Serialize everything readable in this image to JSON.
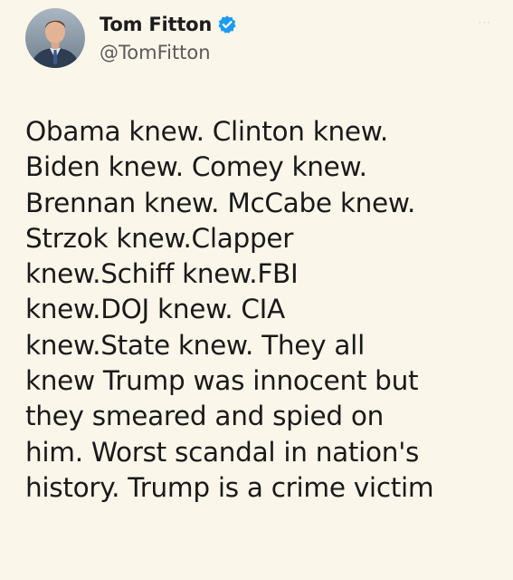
{
  "author": {
    "display_name": "Tom Fitton",
    "handle": "@TomFitton",
    "verified": true,
    "avatar_icon": "profile-photo-icon",
    "verified_icon": "verified-badge-icon"
  },
  "menu": {
    "more_label": "···"
  },
  "tweet": {
    "lines": [
      "Obama knew. Clinton knew.",
      "Biden knew. Comey knew.",
      "Brennan knew. McCabe knew.",
      "Strzok knew.Clapper",
      "knew.Schiff knew.FBI",
      "knew.DOJ knew. CIA",
      "knew.State knew. They all",
      "knew Trump was innocent but",
      "they smeared and spied on",
      "him. Worst scandal in nation's",
      "history. Trump is a crime victim"
    ]
  },
  "colors": {
    "background": "#fbf6ea",
    "verified_blue": "#1d9bf0",
    "text": "#1a1a1a",
    "handle": "#5a5a5a"
  }
}
